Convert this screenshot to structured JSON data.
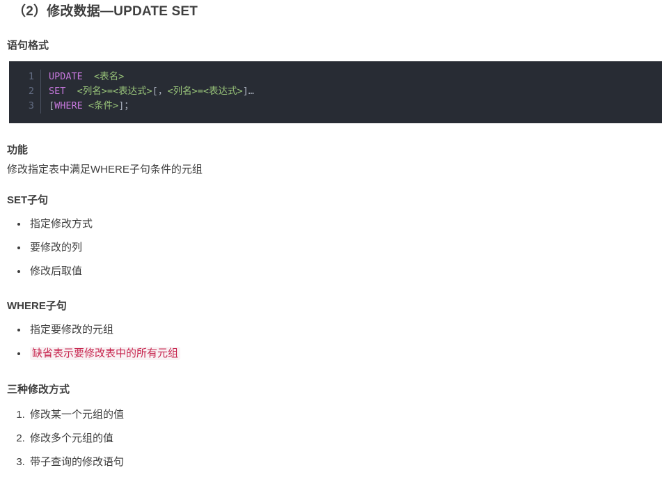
{
  "document": {
    "title": "（2）修改数据—UPDATE SET",
    "sections": {
      "statement_format": {
        "heading": "语句格式",
        "code": {
          "language": "sql",
          "theme_background": "#282c34",
          "keyword_color": "#c678dd",
          "placeholder_color": "#98c379",
          "line_number_color": "#636d83",
          "lines": [
            {
              "number": "1",
              "tokens": [
                {
                  "type": "keyword",
                  "text": "UPDATE"
                },
                {
                  "type": "punctuation",
                  "text": "  "
                },
                {
                  "type": "placeholder",
                  "text": "<表名>"
                }
              ]
            },
            {
              "number": "2",
              "tokens": [
                {
                  "type": "keyword",
                  "text": "SET"
                },
                {
                  "type": "punctuation",
                  "text": "  "
                },
                {
                  "type": "placeholder",
                  "text": "<列名>=<表达式>"
                },
                {
                  "type": "punctuation",
                  "text": "[，"
                },
                {
                  "type": "placeholder",
                  "text": "<列名>=<表达式>"
                },
                {
                  "type": "punctuation",
                  "text": "]…"
                }
              ]
            },
            {
              "number": "3",
              "tokens": [
                {
                  "type": "punctuation",
                  "text": "["
                },
                {
                  "type": "keyword",
                  "text": "WHERE"
                },
                {
                  "type": "punctuation",
                  "text": " "
                },
                {
                  "type": "placeholder",
                  "text": "<条件>"
                },
                {
                  "type": "punctuation",
                  "text": "]；"
                }
              ]
            }
          ]
        }
      },
      "function": {
        "heading": "功能",
        "text": "修改指定表中满足WHERE子句条件的元组"
      },
      "set_clause": {
        "heading": "SET子句",
        "items": [
          {
            "text": "指定修改方式",
            "highlight": false
          },
          {
            "text": "要修改的列",
            "highlight": false
          },
          {
            "text": "修改后取值",
            "highlight": false
          }
        ]
      },
      "where_clause": {
        "heading": "WHERE子句",
        "items": [
          {
            "text": "指定要修改的元组",
            "highlight": false
          },
          {
            "text": "缺省表示要修改表中的所有元组",
            "highlight": true
          }
        ],
        "highlight_text_color": "#c7254e",
        "highlight_background_color": "#f9f2f4"
      },
      "three_methods": {
        "heading": "三种修改方式",
        "items": [
          {
            "number": "1.",
            "text": "修改某一个元组的值"
          },
          {
            "number": "2.",
            "text": "修改多个元组的值"
          },
          {
            "number": "3.",
            "text": "带子查询的修改语句"
          }
        ]
      }
    }
  }
}
